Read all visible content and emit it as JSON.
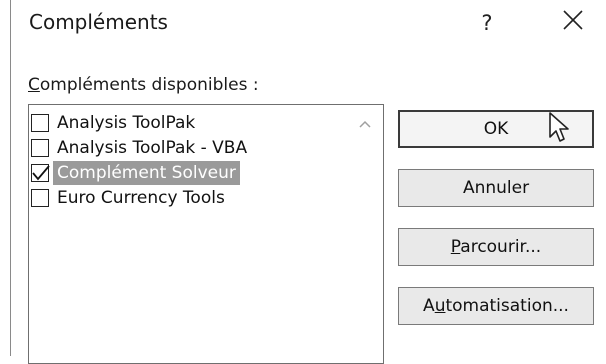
{
  "window": {
    "title": "Compléments",
    "help_label": "?",
    "close_label": "✕"
  },
  "list": {
    "label_prefix": "C",
    "label_rest": "ompléments disponibles :",
    "items": [
      {
        "label": "Analysis ToolPak",
        "checked": false,
        "selected": false
      },
      {
        "label": "Analysis ToolPak - VBA",
        "checked": false,
        "selected": false
      },
      {
        "label": "Complément Solveur",
        "checked": true,
        "selected": true
      },
      {
        "label": "Euro Currency Tools",
        "checked": false,
        "selected": false
      }
    ]
  },
  "buttons": {
    "ok": "OK",
    "cancel": "Annuler",
    "browse_prefix": "P",
    "browse_rest": "arcourir...",
    "automation_prefix": "A",
    "automation_mid": "u",
    "automation_rest": "tomatisation..."
  },
  "colors": {
    "selection_bg": "#9a9a9a",
    "selection_text": "#ffffff"
  }
}
